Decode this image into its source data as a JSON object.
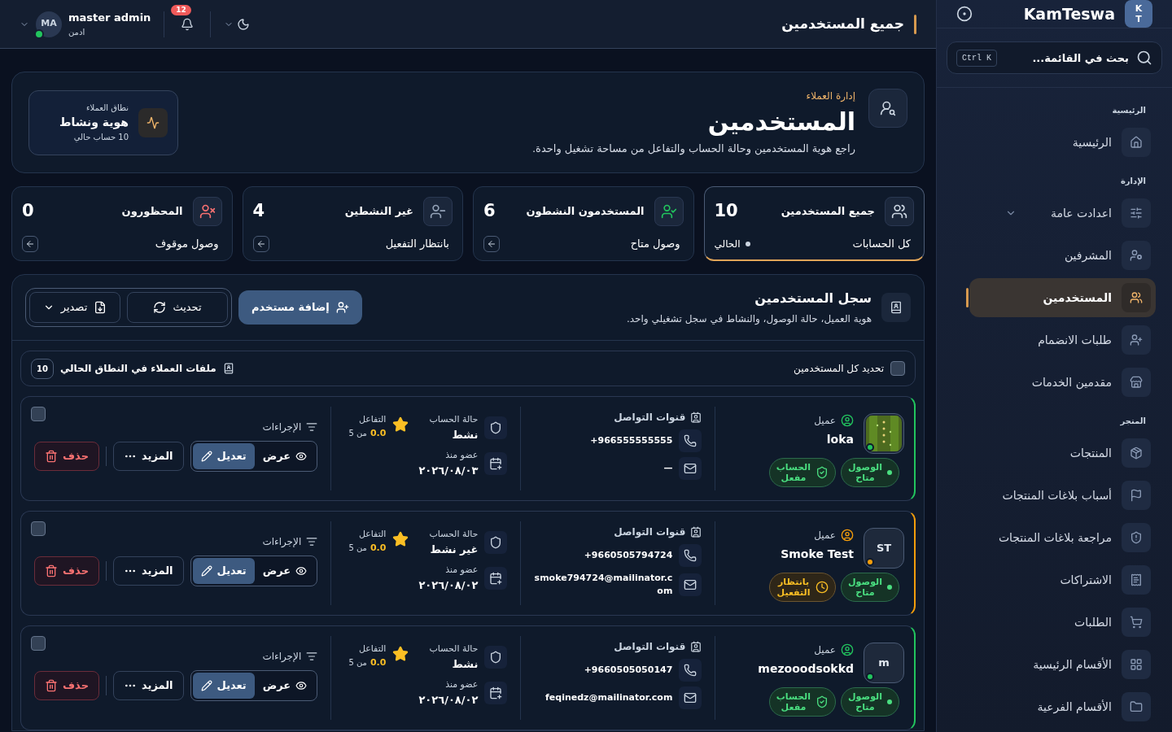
{
  "sidebar": {
    "logo_lines": [
      "K",
      "T"
    ],
    "brand": "KamTeswa",
    "search": {
      "placeholder": "بحث في القائمة...",
      "shortcut": "Ctrl K"
    },
    "sections": [
      {
        "title": "الرئيسية",
        "items": [
          {
            "label": "الرئيسية",
            "selected": false
          }
        ]
      },
      {
        "title": "الإدارة",
        "items": [
          {
            "label": "اعدادت عامة",
            "selected": false,
            "expandable": true
          },
          {
            "label": "المشرفين",
            "selected": false
          },
          {
            "label": "المستخدمين",
            "selected": true
          },
          {
            "label": "طلبات الانضمام",
            "selected": false
          },
          {
            "label": "مقدمين الخدمات",
            "selected": false
          }
        ]
      },
      {
        "title": "المتجر",
        "items": [
          {
            "label": "المنتجات",
            "selected": false
          },
          {
            "label": "أسباب بلاغات المنتجات",
            "selected": false
          },
          {
            "label": "مراجعة بلاغات المنتجات",
            "selected": false
          },
          {
            "label": "الاشتراكات",
            "selected": false
          },
          {
            "label": "الطلبات",
            "selected": false
          },
          {
            "label": "الأقسام الرئيسية",
            "selected": false
          },
          {
            "label": "الأقسام الفرعية",
            "selected": false
          }
        ]
      }
    ]
  },
  "header": {
    "title": "جميع المستخدمين",
    "notifications": "12",
    "user": {
      "name": "master admin",
      "role": "ادمن",
      "initials": "MA",
      "online": true
    }
  },
  "hero": {
    "eyebrow": "إدارة العملاء",
    "title": "المستخدمين",
    "subtitle": "راجع هوية المستخدمين وحالة الحساب والتفاعل من مساحة تشغيل واحدة.",
    "scope": {
      "label": "نطاق العملاء",
      "title": "هوية ونشاط",
      "count": "10 حساب حالي"
    }
  },
  "stats": [
    {
      "title": "جميع المستخدمين",
      "value": "10",
      "caption": "كل الحسابات",
      "current": "الحالي",
      "selected": true,
      "color": "#cbd5e1"
    },
    {
      "title": "المستخدمون النشطون",
      "value": "6",
      "caption": "وصول متاح",
      "selected": false,
      "color": "#22c55e"
    },
    {
      "title": "غير النشطين",
      "value": "4",
      "caption": "بانتظار التفعيل",
      "selected": false,
      "color": "#94a3b8"
    },
    {
      "title": "المحظورون",
      "value": "0",
      "caption": "وصول موقوف",
      "selected": false,
      "color": "#f87171"
    }
  ],
  "registry": {
    "title": "سجل المستخدمين",
    "subtitle": "هوية العميل، حالة الوصول، والنشاط في سجل تشغيلي واحد.",
    "add": "إضافة مستخدم",
    "refresh": "تحديث",
    "export": "تصدير",
    "select_all": {
      "label": "تحديد كل المستخدمين",
      "checked": false
    },
    "files_label": "ملفات العملاء في النطاق الحالي",
    "files_count": "10"
  },
  "users": [
    {
      "name": "loka",
      "role": "عميل",
      "color": "#22c55e",
      "access": "الوصول متاح",
      "account_badge": {
        "kind": "enabled",
        "text": "الحساب مفعل"
      },
      "contacts_title": "قنوات التواصل",
      "phone": "+966555555555",
      "email": "—",
      "state_label": "حالة الحساب",
      "state": "نشط",
      "since_label": "عضو منذ",
      "since": "٢٠٢٦/٠٨/٠٣",
      "engagement_label": "التفاعل",
      "rating": "0.0",
      "rating_suffix": "من 5",
      "actions_label": "الإجراءات",
      "view": "عرض",
      "edit": "تعديل",
      "more": "المزيد",
      "delete": "حذف",
      "selected": false
    },
    {
      "name": "Smoke Test",
      "role": "عميل",
      "avatar": {
        "kind": "initials",
        "text": "ST"
      },
      "color": "#f59e0b",
      "access": "الوصول متاح",
      "account_badge": {
        "kind": "pending",
        "text": "بانتظار التفعيل"
      },
      "contacts_title": "قنوات التواصل",
      "phone": "+9660505794724",
      "email": "smoke794724@mailinator.com",
      "state_label": "حالة الحساب",
      "state": "غير نشط",
      "since_label": "عضو منذ",
      "since": "٢٠٢٦/٠٨/٠٢",
      "engagement_label": "التفاعل",
      "rating": "0.0",
      "rating_suffix": "من 5",
      "actions_label": "الإجراءات",
      "view": "عرض",
      "edit": "تعديل",
      "more": "المزيد",
      "delete": "حذف",
      "selected": false
    },
    {
      "name": "mezooodsokkd",
      "role": "عميل",
      "avatar": {
        "kind": "initials",
        "text": "m"
      },
      "color": "#22c55e",
      "access": "الوصول متاح",
      "account_badge": {
        "kind": "enabled",
        "text": "الحساب مفعل"
      },
      "contacts_title": "قنوات التواصل",
      "phone": "+9660505050147",
      "email": "feqinedz@mailinator.com",
      "state_label": "حالة الحساب",
      "state": "نشط",
      "since_label": "عضو منذ",
      "since": "٢٠٢٦/٠٨/٠٢",
      "engagement_label": "التفاعل",
      "rating": "0.0",
      "rating_suffix": "من 5",
      "actions_label": "الإجراءات",
      "view": "عرض",
      "edit": "تعديل",
      "more": "المزيد",
      "delete": "حذف",
      "selected": false
    }
  ]
}
